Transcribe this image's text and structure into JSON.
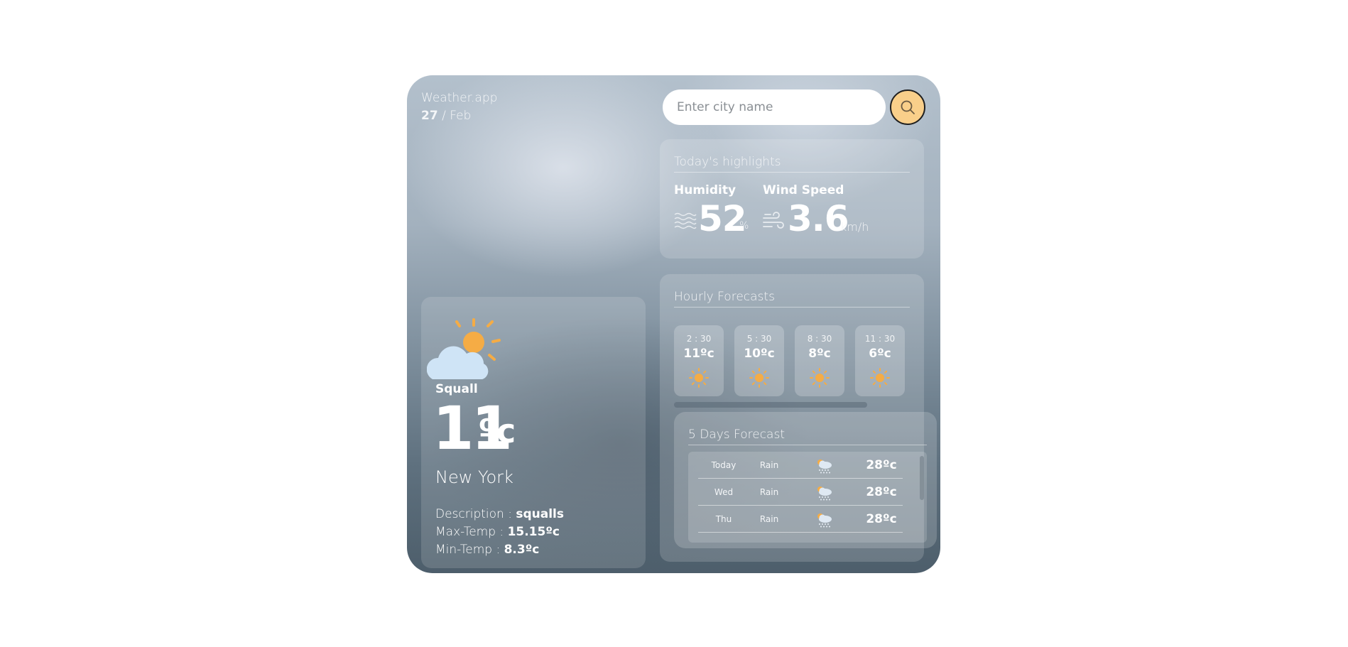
{
  "header": {
    "brand": "Weather.app",
    "date_day": "27",
    "date_sep": " / ",
    "date_month": "Feb"
  },
  "search": {
    "placeholder": "Enter city name"
  },
  "highlights": {
    "title": "Today's highlights",
    "humidity": {
      "label": "Humidity",
      "value": "52",
      "unit": "%"
    },
    "wind": {
      "label": "Wind Speed",
      "value": "3.6",
      "unit": "km/h"
    }
  },
  "hourly": {
    "title": "Hourly Forecasts",
    "items": [
      {
        "time": "2 : 30",
        "temp": "11ºc",
        "icon": "sun-icon"
      },
      {
        "time": "5 : 30",
        "temp": "10ºc",
        "icon": "sun-icon"
      },
      {
        "time": "8 : 30",
        "temp": "8ºc",
        "icon": "sun-icon"
      },
      {
        "time": "11 : 30",
        "temp": "6ºc",
        "icon": "sun-icon"
      }
    ]
  },
  "five_day": {
    "title": "5 Days Forecast",
    "items": [
      {
        "day": "Today",
        "desc": "Rain",
        "temp": "28ºc",
        "icon": "rain-cloud-icon"
      },
      {
        "day": "Wed",
        "desc": "Rain",
        "temp": "28ºc",
        "icon": "rain-cloud-icon"
      },
      {
        "day": "Thu",
        "desc": "Rain",
        "temp": "28ºc",
        "icon": "rain-cloud-icon"
      }
    ]
  },
  "current": {
    "icon": "partly-cloudy-icon",
    "condition": "Squall",
    "temp": "11",
    "temp_unit": "ºc",
    "city": "New York",
    "description_label": "Description : ",
    "description": "squalls",
    "max_label": "Max-Temp : ",
    "max": "15.15ºc",
    "min_label": "Min-Temp : ",
    "min": "8.3ºc"
  },
  "colors": {
    "search_button": "#f9cf8a",
    "sun": "#f5ac45",
    "cloud": "#cfe4f6"
  }
}
